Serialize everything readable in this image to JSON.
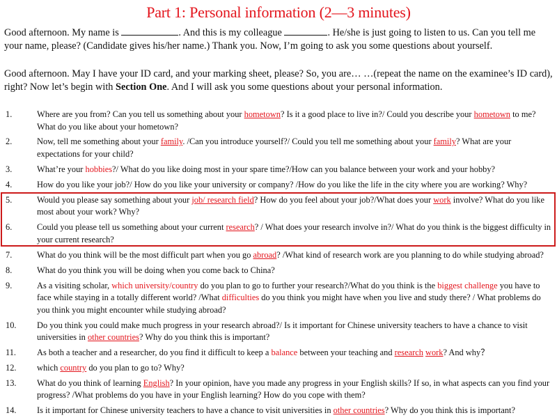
{
  "title": "Part 1: Personal information  (2—3 minutes)",
  "intro1": {
    "a": " Good afternoon. My name is ",
    "b": ". And this is my colleague ",
    "c": ". He/she is just going to listen to us. Can you tell me your name, please? (Candidate gives his/her name.) Thank you. Now, I’m going to ask you some questions about yourself."
  },
  "intro2": {
    "a": "Good afternoon.  May I have your ID card, and your marking sheet, please? So, you are… …(repeat the name on the examinee’s ID card), right?  Now let’s begin with ",
    "bold": "Section One",
    "c": ". And I will ask you some questions about your personal information."
  },
  "highlight_color": "#cc1a1a",
  "accent_color": "#e3141c",
  "questions": [
    {
      "num": "1.",
      "parts": [
        {
          "t": "Where are you from? Can you tell us something about your "
        },
        {
          "t": "hometown",
          "red": true,
          "u": true
        },
        {
          "t": "? Is it a good place to live in?/ Could you describe your "
        },
        {
          "t": "hometown",
          "red": true,
          "u": true
        },
        {
          "t": " to me? What do you like about your hometown?"
        }
      ]
    },
    {
      "num": "2.",
      "parts": [
        {
          "t": "Now, tell me something about your "
        },
        {
          "t": "family",
          "red": true,
          "u": true
        },
        {
          "t": ".  /Can you introduce yourself?/ Could you tell me something about your "
        },
        {
          "t": "family",
          "red": true,
          "u": true
        },
        {
          "t": "?  What are your expectations for your child?"
        }
      ]
    },
    {
      "num": "3.",
      "parts": [
        {
          "t": "What’re your "
        },
        {
          "t": "hobbies",
          "red": true
        },
        {
          "t": "?/ What do you like doing most in your spare time?/How can you balance between your work and your hobby?"
        }
      ]
    },
    {
      "num": "4.",
      "parts": [
        {
          "t": "How do you like your job?/ How do you like your university or company? /How do you like the life in the city where you are working? Why?"
        }
      ]
    },
    {
      "num": "5.",
      "parts": [
        {
          "t": "Would you please say something about your "
        },
        {
          "t": "job/ research field",
          "red": true,
          "u": true
        },
        {
          "t": "? How do you feel about your job?/What does your "
        },
        {
          "t": "work",
          "red": true,
          "u": true
        },
        {
          "t": " involve? What do you like most about your work? Why?"
        }
      ]
    },
    {
      "num": "6.",
      "parts": [
        {
          "t": "Could you please tell us something about your current "
        },
        {
          "t": "research",
          "red": true,
          "u": true
        },
        {
          "t": "? / What does your research involve in?/ What do you think is the biggest difficulty in your current research?"
        }
      ]
    },
    {
      "num": "7.",
      "parts": [
        {
          "t": "What do you think will be the most difficult part when you go "
        },
        {
          "t": "abroad",
          "red": true,
          "u": true
        },
        {
          "t": "? /What kind of research work are you planning to do while studying abroad?"
        }
      ]
    },
    {
      "num": "8.",
      "parts": [
        {
          "t": "What do you think you will be doing when you come back to China?"
        }
      ]
    },
    {
      "num": "9.",
      "parts": [
        {
          "t": "As a visiting scholar, "
        },
        {
          "t": "which university/country",
          "red": true
        },
        {
          "t": " do you plan to go to further your research?/What do you think is the "
        },
        {
          "t": "biggest challenge",
          "red": true
        },
        {
          "t": " you have to face while staying in a totally different world? /What "
        },
        {
          "t": "difficulties",
          "red": true
        },
        {
          "t": "  do you think you might have when you live and study there? / What problems do you think you might encounter while studying abroad?"
        }
      ]
    },
    {
      "num": "10.",
      "parts": [
        {
          "t": "Do you think you could make much progress in your research abroad?/ Is it important for Chinese university teachers to have a chance to visit universities in "
        },
        {
          "t": "other countries",
          "red": true,
          "u": true
        },
        {
          "t": "? Why do you think this is important?"
        }
      ]
    },
    {
      "num": "11.",
      "parts": [
        {
          "t": "As both a teacher and a researcher, do you find it difficult to keep a "
        },
        {
          "t": "balance",
          "red": true
        },
        {
          "t": " between your teaching and "
        },
        {
          "t": "research",
          "red": true,
          "u": true
        },
        {
          "t": " "
        },
        {
          "t": "work",
          "red": true,
          "u": true
        },
        {
          "t": "? And why？"
        }
      ]
    },
    {
      "num": "12.",
      "parts": [
        {
          "t": "which "
        },
        {
          "t": "country",
          "red": true,
          "u": true
        },
        {
          "t": " do you plan to go to? Why?"
        }
      ]
    },
    {
      "num": "13.",
      "parts": [
        {
          "t": "What do you think of learning "
        },
        {
          "t": "English",
          "red": true,
          "u": true
        },
        {
          "t": "? In your opinion, have you made any progress in your English skills? If so, in what aspects can you find your progress? /What problems do you have in your English learning? How do you cope with them?"
        }
      ]
    },
    {
      "num": "14.",
      "parts": [
        {
          "t": "Is it important for Chinese university teachers to have a chance to visit universities in "
        },
        {
          "t": "other countries",
          "red": true,
          "u": true
        },
        {
          "t": "? Why do you think this is important?"
        }
      ]
    }
  ]
}
